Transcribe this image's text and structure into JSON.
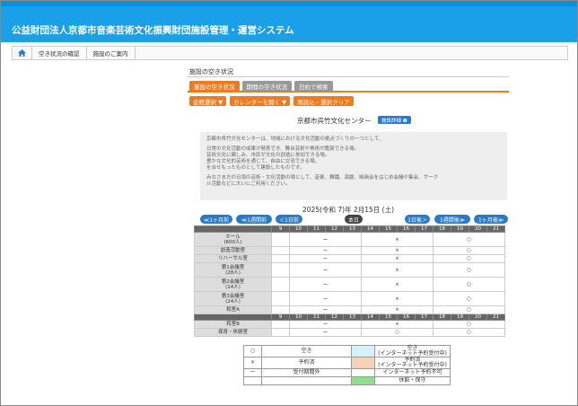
{
  "app": {
    "title": "公益財団法人京都市音楽芸術文化振興財団施設管理・運営システム"
  },
  "nav": {
    "items": [
      "空き状況の確認",
      "施設のご案内"
    ]
  },
  "section": {
    "title": "施設の空き状況"
  },
  "tabs": [
    "施設の空き状況",
    "期間の空き状況",
    "日約で検索"
  ],
  "actions": [
    "会館選択 ▼",
    "カレンダーを開く ▼",
    "再読込・選択クリア"
  ],
  "facility": {
    "name": "京都市呉竹文化センター",
    "detail_label": "施設詳細 ❶"
  },
  "description": {
    "lines1": [
      "京都市呉竹文化センターは、地域における文化活動の拠点づくりの一つとして、"
    ],
    "lines2": [
      "日常の文化活動の成果が発表でき、舞台芸術や美術が鑑賞できる場。",
      "芸術文化に親しみ、市民が文化の創造に参加できる場。",
      "豊かな文化的芸術を通じて、自由に交流できる場。",
      "を合せもったものとして建設したものです。"
    ],
    "lines3": [
      "みなさま方の日頃の芸術・文化活動の場として、音楽、舞踊、演劇、映画会をはじめ会議や集会、サーク",
      "ル活動などに大いにご利用ください。"
    ]
  },
  "date_label": "2025(令和 7)年 2月15日 (土)",
  "date_nav": {
    "prev_month": "≪1ヶ月前",
    "prev_week": "≪1週間前",
    "prev_day": "＜1日前",
    "today": "本日",
    "next_day": "1日後＞",
    "next_week": "1週間後≫",
    "next_month": "1ヶ月後≫"
  },
  "hours": [
    "9",
    "10",
    "11",
    "12",
    "13",
    "14",
    "15",
    "16",
    "17",
    "18",
    "19",
    "20",
    "21"
  ],
  "facilities_a": [
    {
      "name": "ホール",
      "sub": "(600人)",
      "marks": [
        "",
        "ー",
        "",
        "",
        "",
        "×",
        "",
        "",
        "",
        "○",
        "",
        "",
        ""
      ]
    },
    {
      "name": "創造活動室",
      "sub": "",
      "marks": [
        "",
        "ー",
        "",
        "",
        "",
        "×",
        "",
        "",
        "",
        "○",
        "",
        "",
        ""
      ]
    },
    {
      "name": "リハーサル室",
      "sub": "",
      "marks": [
        "",
        "ー",
        "",
        "",
        "",
        "×",
        "",
        "",
        "",
        "○",
        "",
        "",
        ""
      ]
    },
    {
      "name": "第1会議室",
      "sub": "(28人)",
      "marks": [
        "",
        "ー",
        "",
        "",
        "",
        "×",
        "",
        "",
        "",
        "○",
        "",
        "",
        ""
      ]
    },
    {
      "name": "第2会議室",
      "sub": "(14人)",
      "marks": [
        "",
        "ー",
        "",
        "",
        "",
        "×",
        "",
        "",
        "",
        "○",
        "",
        "",
        ""
      ]
    },
    {
      "name": "第3会議室",
      "sub": "(24人)",
      "marks": [
        "",
        "ー",
        "",
        "",
        "",
        "×",
        "",
        "",
        "",
        "○",
        "",
        "",
        ""
      ]
    },
    {
      "name": "和室A",
      "sub": "",
      "marks": [
        "",
        "ー",
        "",
        "",
        "",
        "×",
        "",
        "",
        "",
        "○",
        "",
        "",
        ""
      ]
    }
  ],
  "facilities_b": [
    {
      "name": "和室B",
      "sub": "",
      "marks": [
        "",
        "ー",
        "",
        "",
        "",
        "×",
        "",
        "",
        "",
        "○",
        "",
        "",
        ""
      ]
    },
    {
      "name": "保育・休憩室",
      "sub": "",
      "marks": [
        "",
        "ー",
        "",
        "",
        "",
        "○",
        "",
        "",
        "",
        "○",
        "",
        "",
        ""
      ]
    }
  ],
  "legend": [
    {
      "sym": "○",
      "label": "空き",
      "sym2": "",
      "label2": "空き\n(インターネット予約受付中)",
      "color2": "#d6f2f6"
    },
    {
      "sym": "×",
      "label": "予約済",
      "sym2": "",
      "label2": "予約済\n(インターネット予約受付中)",
      "color2": "#f7d2b6"
    },
    {
      "sym": "ー",
      "label": "受付期間外",
      "sym2": "",
      "label2": "インターネット予約不可",
      "color2": "#ffffff"
    },
    {
      "sym": "",
      "label": "",
      "sym2": "",
      "label2": "休館・保守",
      "color2": "#8ee08e"
    }
  ]
}
